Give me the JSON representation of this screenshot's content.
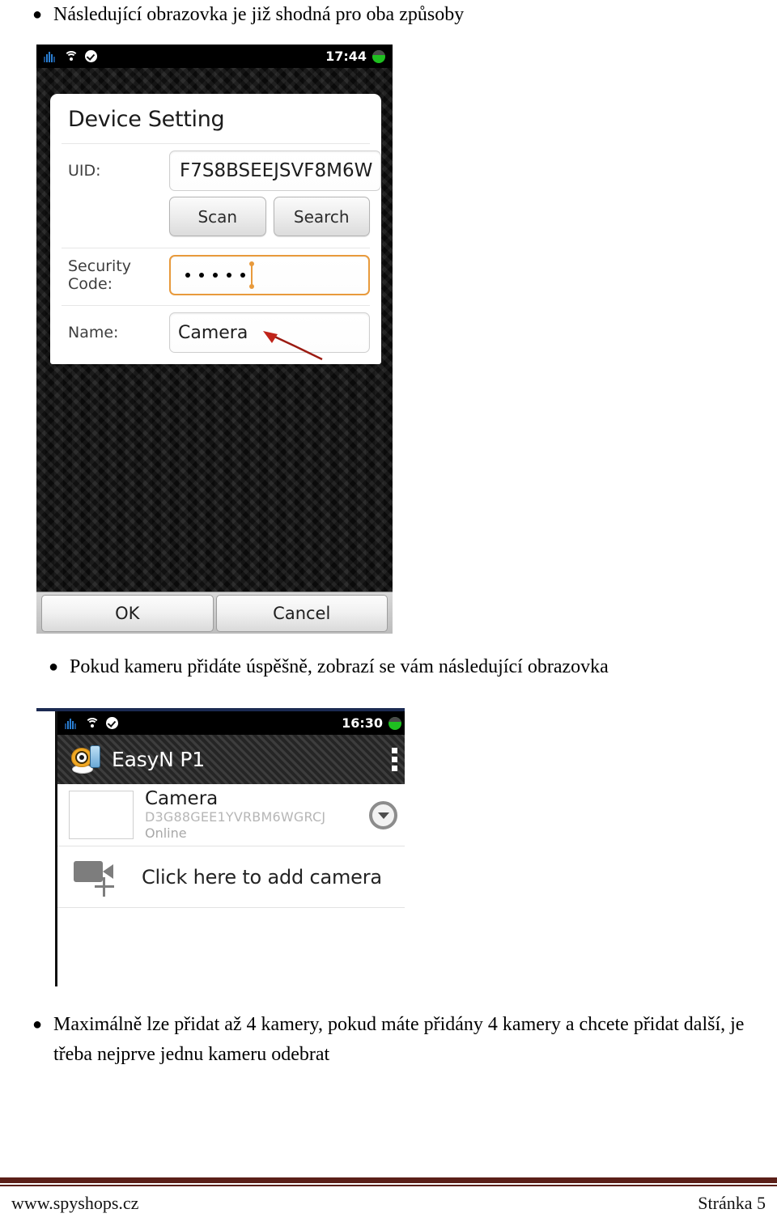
{
  "document": {
    "bullets": [
      {
        "id": "b1",
        "text": "Následující obrazovka je již shodná pro oba způsoby"
      },
      {
        "id": "b2",
        "text": "Pokud kameru přidáte úspěšně, zobrazí se vám následující obrazovka"
      },
      {
        "id": "b3",
        "text": "Maximálně lze přidat až 4 kamery, pokud máte přidány 4 kamery a chcete přidat další, je třeba nejprve jednu kameru odebrat"
      }
    ],
    "bullet_marker": "●"
  },
  "screenshot1": {
    "statusbar": {
      "time": "17:44",
      "icons": [
        "signal-icon",
        "wifi-icon",
        "check-badge-icon",
        "battery-icon"
      ]
    },
    "dialog": {
      "title": "Device Setting",
      "fields": {
        "uid": {
          "label": "UID:",
          "value": "F7S8BSEEJSVF8M6W"
        },
        "security_code": {
          "label": "Security Code:",
          "value": "• • • • •",
          "dots": 5,
          "focused": true
        },
        "name": {
          "label": "Name:",
          "value": "Camera"
        }
      },
      "buttons": {
        "scan": "Scan",
        "search": "Search"
      }
    },
    "footer_buttons": {
      "ok": "OK",
      "cancel": "Cancel"
    },
    "annotation": {
      "type": "red-arrow",
      "color": "#9b1b12",
      "points_to": "security-code-field"
    },
    "colors": {
      "focus_border": "#e89a3c",
      "status_bar_bg": "#000000",
      "battery": "#1fc020"
    }
  },
  "screenshot2": {
    "statusbar": {
      "time": "16:30",
      "icons": [
        "signal-icon",
        "wifi-icon",
        "check-badge-icon",
        "battery-icon"
      ]
    },
    "appbar": {
      "title": "EasyN P1",
      "logo": "camera-phone-logo-icon",
      "overflow": "overflow-menu-icon"
    },
    "camera_item": {
      "name": "Camera",
      "uid": "D3G88GEE1YVRBM6WGRCJ",
      "status": "Online",
      "expand": "chevron-down-icon"
    },
    "add_camera": {
      "label": "Click here to add camera",
      "icon": "add-camera-icon"
    },
    "colors": {
      "top_border": "#1b2a52",
      "appbar_bg": "#2e2e2e"
    }
  },
  "page_footer": {
    "site": "www.spyshops.cz",
    "page": "Stránka 5",
    "rule_color": "#5b1f18"
  }
}
